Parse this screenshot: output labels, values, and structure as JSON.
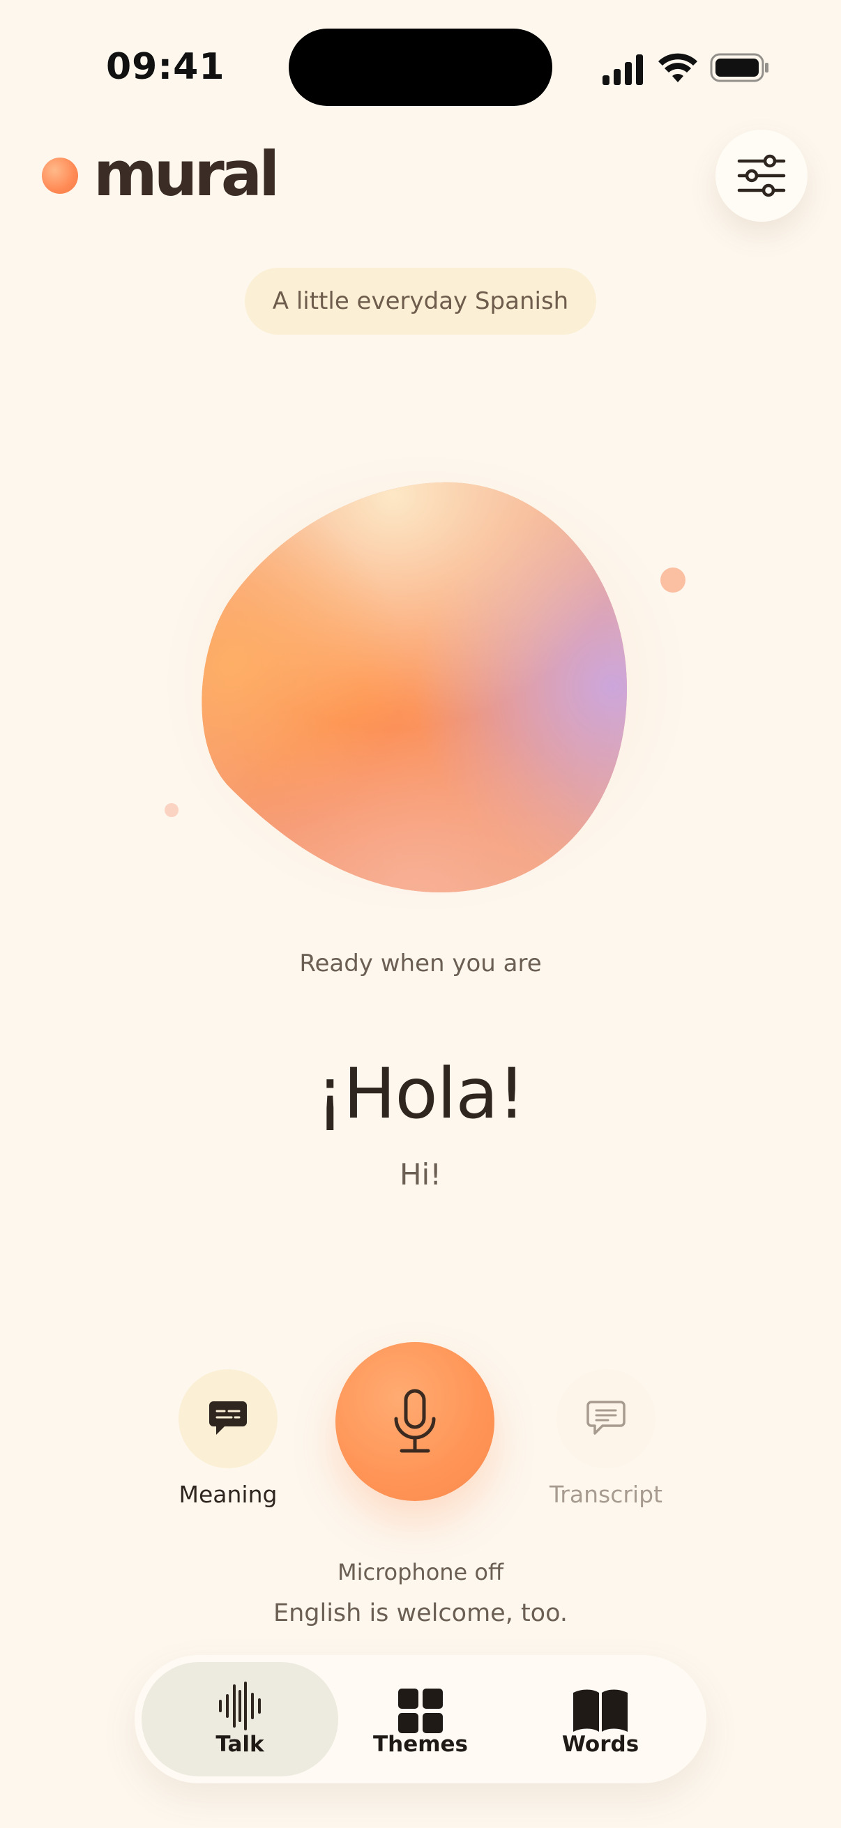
{
  "status_bar": {
    "time": "09:41",
    "icons": [
      "cellular-signal-icon",
      "wifi-icon",
      "battery-icon"
    ]
  },
  "header": {
    "logo_text": "mural",
    "settings_icon": "sliders-icon"
  },
  "topic": {
    "label": "A little everyday Spanish"
  },
  "conversation": {
    "status": "Ready when you are",
    "phrase": "¡Hola!",
    "translation": "Hi!"
  },
  "controls": {
    "meaning": {
      "label": "Meaning",
      "icon": "speech-bubble-icon"
    },
    "mic": {
      "icon": "microphone-icon"
    },
    "transcript": {
      "label": "Transcript",
      "icon": "message-lines-icon"
    }
  },
  "mic_status": "Microphone off",
  "hint": "English is welcome, too.",
  "tabbar": {
    "tabs": [
      {
        "label": "Talk",
        "icon": "waveform-icon",
        "selected": true
      },
      {
        "label": "Themes",
        "icon": "grid-icon",
        "selected": false
      },
      {
        "label": "Words",
        "icon": "book-icon",
        "selected": false
      }
    ]
  },
  "colors": {
    "background": "#fdf7ee",
    "accent": "#ff9456",
    "pill": "#fbf0d5"
  }
}
